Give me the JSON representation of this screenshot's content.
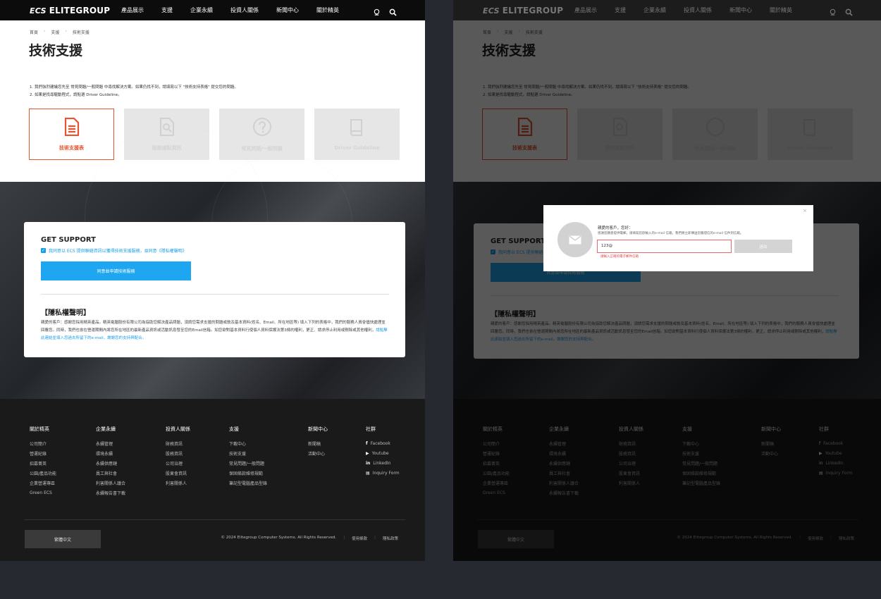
{
  "nav": {
    "logo_mark": "ECS",
    "logo_text": "ELITEGROUP",
    "items": [
      "產品展示",
      "支援",
      "企業永續",
      "投資人關係",
      "新聞中心",
      "關於精英"
    ]
  },
  "breadcrumb": [
    "首頁",
    "支援",
    "技術支援"
  ],
  "page_title": "技術支援",
  "notes": [
    "1. 我們強烈建議您先至 常見問題/一般問題 中尋找解決方案。如果仍找不到，請填寫以下 \"技術支持表格\" 提交您的問題。",
    "2. 如果是找尋驅動程式，請點選 Driver Guideline。"
  ],
  "cards": [
    {
      "label": "技術支援表",
      "icon": "document-icon",
      "active": true
    },
    {
      "label": "服務據點資訊",
      "icon": "search-document-icon",
      "active": false
    },
    {
      "label": "常見問題/一般問題",
      "icon": "question-icon",
      "active": false
    },
    {
      "label": "Driver Guideline",
      "icon": "book-icon",
      "active": false
    }
  ],
  "support": {
    "title": "GET SUPPORT",
    "consent": "我同意以 ECS 提供聯絡資訊以獲得技術支援服務，並同意《隱私權聲明》",
    "button": "同意並申請技術服務",
    "privacy_title": "【隱私權聲明】",
    "privacy_text": "親愛的客戶：感謝您採用精英產品。精英電腦股份有限公司為協助您解決產品問題，須請您需求支援的問題或敘及基本資料(姓名、Email、所在地區等) 填入下列的表格中，我們的服務人員會儘快處理並回覆您。同時，我們也會在營運期間內將您所在地區的最新產品資訊或活動訊息發至您的Email信箱。如您欲對基本資料行使個人資料保護法第3條的權利，更正、請求停止利用或刪除或其他權利，",
    "privacy_link": "請點擊此連結並填入您過去所留下的e-mail，謝謝您的支持與配合。"
  },
  "footer": {
    "columns": [
      {
        "title": "關於精英",
        "items": [
          "公司簡介",
          "營運紀錄",
          "招募菁英",
          "公園/產品功能",
          "企業營運專區",
          "Green ECS"
        ]
      },
      {
        "title": "企業永續",
        "items": [
          "永續管理",
          "環境永續",
          "永續供應鏈",
          "員工與社會",
          "利害關係人議合",
          "永續報告書下載"
        ]
      },
      {
        "title": "投資人關係",
        "items": [
          "財務資訊",
          "股務資訊",
          "公司治理",
          "股東會資訊",
          "利害關係人"
        ]
      },
      {
        "title": "支援",
        "items": [
          "下載中心",
          "技術支援",
          "常見問題/一般問題",
          "保固條款維修規範",
          "筆記型電腦產品型錄"
        ]
      },
      {
        "title": "新聞中心",
        "items": [
          "新聞稿",
          "活動中心"
        ]
      },
      {
        "title": "社群",
        "items": [
          "Facebook",
          "Youtube",
          "LinkedIn",
          "Inquiry Form"
        ],
        "icons": [
          "facebook-icon",
          "youtube-icon",
          "linkedin-icon",
          "form-icon"
        ]
      }
    ],
    "language": "繁體中文",
    "copyright": "© 2024 Elitegroup Computer Systems. All Rights Reserved.",
    "links": [
      "使用條款",
      "隱私政策"
    ]
  },
  "modal": {
    "greeting": "親愛的客戶，您好：",
    "instruction": "感謝您願意提供電郵，請填寫您欲輸入的e-mail 信箱，我們將立即傳送您驗證信的e-mail 信件到信箱。",
    "input_value": "123@",
    "error": "請輸入正確的電子郵件信箱",
    "send_button": "送出",
    "close": "×"
  },
  "colors": {
    "accent": "#e8542e",
    "primary_button": "#1ea7f0",
    "link": "#1a9ee6",
    "nav_bg": "#0c0c0c"
  }
}
